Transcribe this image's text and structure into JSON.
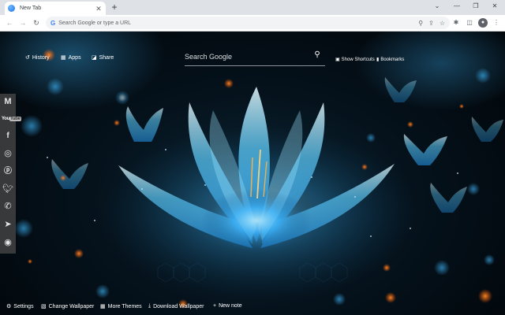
{
  "browser": {
    "tab_title": "New Tab",
    "tab_close": "✕",
    "new_tab": "+",
    "omnibox_placeholder": "Search Google or type a URL"
  },
  "icons": {
    "back": "back-arrow-icon",
    "forward": "forward-arrow-icon",
    "reload": "reload-icon",
    "google": "google-g-icon",
    "zoom": "zoom-icon",
    "share": "share-icon",
    "bookmark_star": "star-icon",
    "extensions": "puzzle-icon",
    "side_panel": "side-panel-icon",
    "profile": "profile-avatar-icon",
    "menu": "kebab-menu-icon"
  },
  "top_links": {
    "history": "History",
    "apps": "Apps",
    "share": "Share"
  },
  "search": {
    "placeholder": "Search Google"
  },
  "right_links": {
    "show_shortcuts": "Show Shortcuts",
    "bookmarks": "Bookmarks"
  },
  "social": {
    "items": [
      "gmail-icon",
      "youtube-icon",
      "facebook-icon",
      "instagram-icon",
      "pinterest-icon",
      "twitter-icon",
      "whatsapp-icon",
      "telegram-icon",
      "reddit-icon"
    ],
    "youtube_you": "You",
    "youtube_tube": "Tube"
  },
  "bottom_bar": {
    "settings": "Settings",
    "change_wallpaper": "Change Wallpaper",
    "more_themes": "More Themes",
    "download_wallpaper": "Download Wallpaper",
    "new_note": "New note"
  },
  "colors": {
    "chrome_tabstrip": "#dee1e6",
    "glow_blue": "#4fc3ff",
    "ember_orange": "#ff7a1a"
  }
}
